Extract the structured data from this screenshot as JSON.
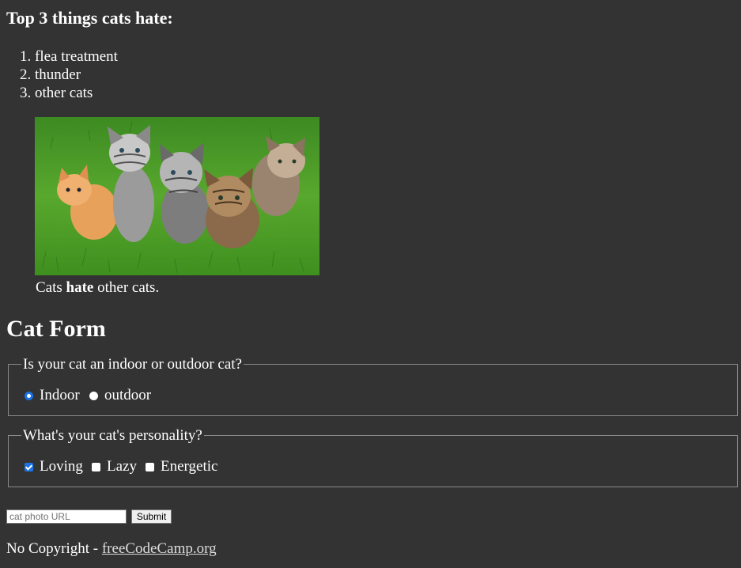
{
  "hate_section": {
    "title": "Top 3 things cats hate:",
    "items": [
      "flea treatment",
      "thunder",
      "other cats"
    ]
  },
  "figure": {
    "caption_pre": "Cats ",
    "caption_bold": "hate",
    "caption_post": " other cats."
  },
  "form": {
    "title": "Cat Form",
    "environment": {
      "legend": "Is your cat an indoor or outdoor cat?",
      "options": [
        {
          "label": "Indoor",
          "checked": true
        },
        {
          "label": "outdoor",
          "checked": false
        }
      ]
    },
    "personality": {
      "legend": "What's your cat's personality?",
      "options": [
        {
          "label": "Loving",
          "checked": true
        },
        {
          "label": "Lazy",
          "checked": false
        },
        {
          "label": "Energetic",
          "checked": false
        }
      ]
    },
    "url_placeholder": "cat photo URL",
    "submit_label": "Submit"
  },
  "footer": {
    "text": "No Copyright - ",
    "link_label": "freeCodeCamp.org"
  },
  "colors": {
    "background": "#333333",
    "text": "#ffffff",
    "accent": "#1a73e8",
    "grass": "#4f9a2a"
  }
}
